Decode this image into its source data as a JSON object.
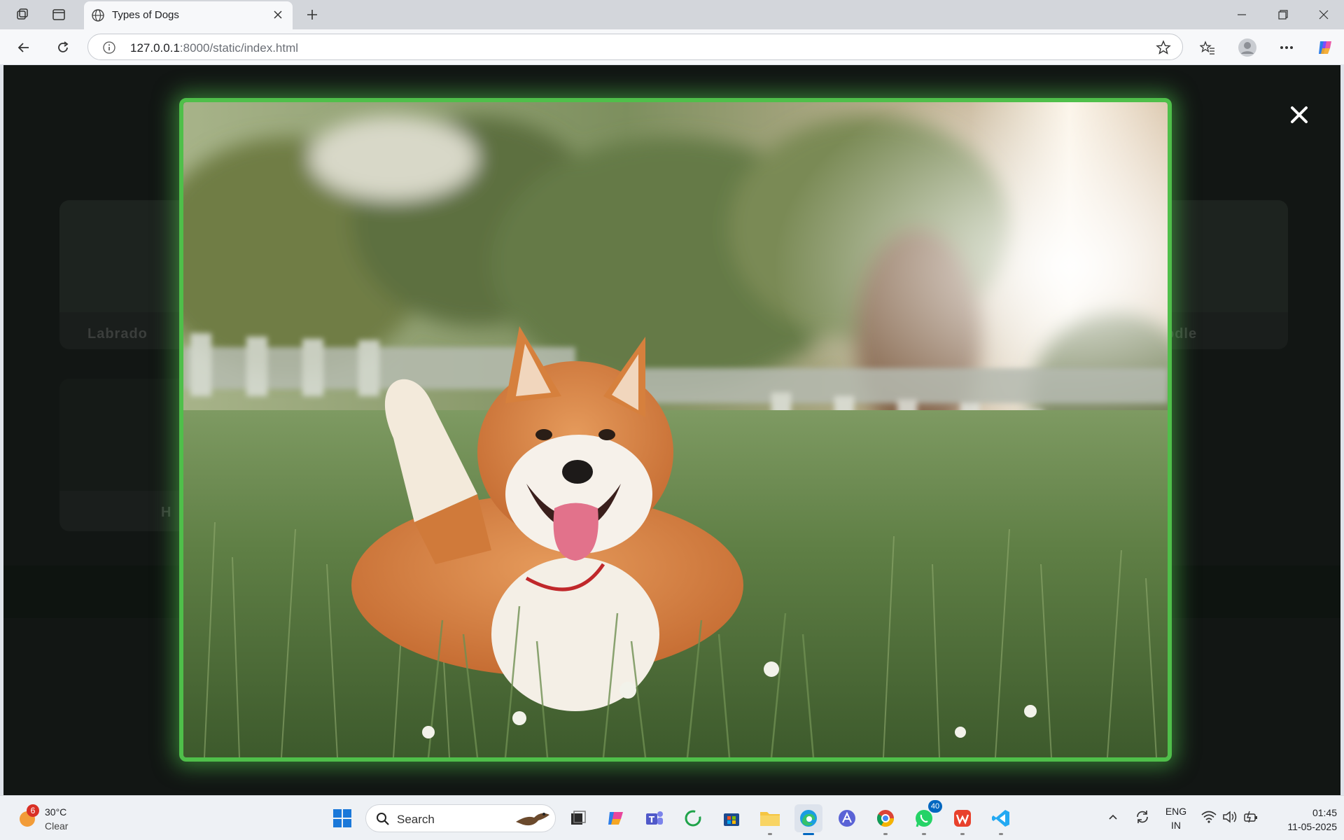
{
  "browser": {
    "tab_title": "Types of Dogs",
    "url_host": "127.0.0.1",
    "url_path": ":8000/static/index.html"
  },
  "page": {
    "background_cards": [
      {
        "label": "Labrado"
      },
      {
        "label": "odle"
      },
      {
        "label": "H"
      }
    ],
    "modal": {
      "image_subject": "shiba-inu-in-grass",
      "frame_color": "#4fbf4a"
    }
  },
  "taskbar": {
    "weather_temp": "30°C",
    "weather_condition": "Clear",
    "weather_badge": "6",
    "search_label": "Search",
    "whatsapp_badge": "40",
    "language": "ENG",
    "region": "IN",
    "time": "01:45",
    "date": "11-05-2025"
  }
}
